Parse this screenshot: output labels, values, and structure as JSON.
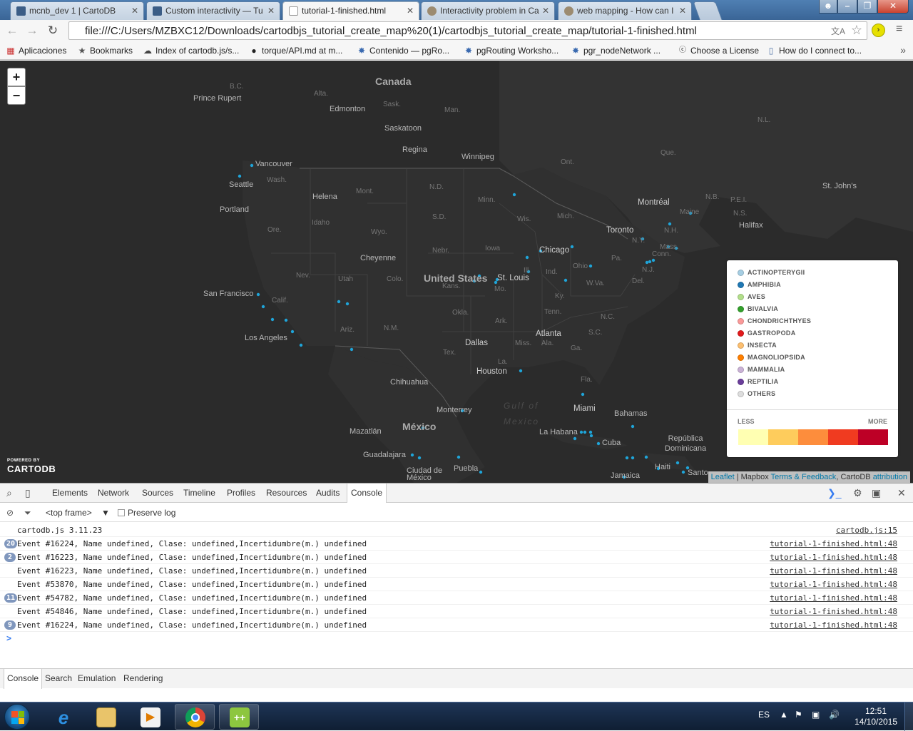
{
  "browser": {
    "tabs": [
      {
        "title": "mcnb_dev 1 | CartoDB",
        "favicon_color": "#3b5d86"
      },
      {
        "title": "Custom interactivity — Tu",
        "favicon_color": "#3b5d86"
      },
      {
        "title": "tutorial-1-finished.html",
        "favicon_color": "#ffffff"
      },
      {
        "title": "Interactivity problem in Ca",
        "favicon_color": "#9c8b70"
      },
      {
        "title": "web mapping - How can I",
        "favicon_color": "#9c8b70"
      }
    ],
    "url": "file:///C:/Users/MZBXC12/Downloads/cartodbjs_tutorial_create_map%20(1)/cartodbjs_tutorial_create_map/tutorial-1-finished.html",
    "bookmarks": [
      {
        "label": "Aplicaciones",
        "icon": "apps-grid-icon"
      },
      {
        "label": "Bookmarks",
        "icon": "star-icon"
      },
      {
        "label": "Index of cartodb.js/s...",
        "icon": "cloud-icon"
      },
      {
        "label": "torque/API.md at m...",
        "icon": "github-icon"
      },
      {
        "label": "Contenido — pgRo...",
        "icon": "pgrouting-icon"
      },
      {
        "label": "pgRouting Worksho...",
        "icon": "pgrouting-icon"
      },
      {
        "label": "pgr_nodeNetwork ...",
        "icon": "pgrouting-icon"
      },
      {
        "label": "Choose a License",
        "icon": "cc-icon"
      },
      {
        "label": "How do I connect to...",
        "icon": "page-icon"
      }
    ]
  },
  "map": {
    "zoom_in": "+",
    "zoom_out": "−",
    "countries": {
      "canada": "Canada",
      "usa": "United States",
      "mexico": "México"
    },
    "cities": {
      "prince_rupert": "Prince Rupert",
      "edmonton": "Edmonton",
      "saskatoon": "Saskatoon",
      "regina": "Regina",
      "winnipeg": "Winnipeg",
      "vancouver": "Vancouver",
      "seattle": "Seattle",
      "portland": "Portland",
      "helena": "Helena",
      "cheyenne": "Cheyenne",
      "san_francisco": "San Francisco",
      "los_angeles": "Los Angeles",
      "chicago": "Chicago",
      "st_louis": "St. Louis",
      "toronto": "Toronto",
      "montreal": "Montréal",
      "halifax": "Halifax",
      "st_johns": "St. John's",
      "dallas": "Dallas",
      "houston": "Houston",
      "atlanta": "Atlanta",
      "miami": "Miami",
      "chihuahua": "Chihuahua",
      "monterrey": "Monterrey",
      "mazatlan": "Mazatlán",
      "guadalajara": "Guadalajara",
      "ciudad_de_mexico": "Ciudad de\nMéxico",
      "puebla": "Puebla",
      "la_habana": "La Habana",
      "cuba": "Cuba",
      "bahamas": "Bahamas",
      "republica_dominicana": "República\nDominicana",
      "haiti": "Haiti",
      "jamaica": "Jamaica",
      "santo": "Santo"
    },
    "regions": {
      "bc": "B.C.",
      "alta": "Alta.",
      "sask": "Sask.",
      "man": "Man.",
      "ont": "Ont.",
      "que": "Que.",
      "nl": "N.L.",
      "nb": "N.B.",
      "pei": "P.E.I.",
      "ns": "N.S.",
      "wash": "Wash.",
      "ore": "Ore.",
      "idaho": "Idaho",
      "mont": "Mont.",
      "wyo": "Wyo.",
      "nd": "N.D.",
      "sd": "S.D.",
      "nebr": "Nebr.",
      "minn": "Minn.",
      "wis": "Wis.",
      "mich": "Mich.",
      "iowa": "Iowa",
      "nev": "Nev.",
      "utah": "Utah",
      "colo": "Colo.",
      "kans": "Kans.",
      "mo": "Mo.",
      "ill": "Ill.",
      "ind": "Ind.",
      "ohio": "Ohio",
      "calif": "Calif.",
      "ariz": "Ariz.",
      "nm": "N.M.",
      "okla": "Okla.",
      "ark": "Ark.",
      "ky": "Ky.",
      "tenn": "Tenn.",
      "wva": "W.Va.",
      "pa": "Pa.",
      "ny": "N.Y.",
      "nj": "N.J.",
      "del": "Del.",
      "nc": "N.C.",
      "sc": "S.C.",
      "tex": "Tex.",
      "miss": "Miss.",
      "ala": "Ala.",
      "ga": "Ga.",
      "la": "La.",
      "fla": "Fla.",
      "maine": "Maine",
      "nh": "N.H.",
      "mass": "Mass.",
      "conn": "Conn."
    },
    "sea_label": "Gulf of\nMexico",
    "legend": {
      "items": [
        {
          "label": "ACTINOPTERYGII",
          "color": "#a6cee3"
        },
        {
          "label": "AMPHIBIA",
          "color": "#1f78b4"
        },
        {
          "label": "AVES",
          "color": "#b2df8a"
        },
        {
          "label": "BIVALVIA",
          "color": "#33a02c"
        },
        {
          "label": "CHONDRICHTHYES",
          "color": "#fb9a99"
        },
        {
          "label": "GASTROPODA",
          "color": "#e31a1c"
        },
        {
          "label": "INSECTA",
          "color": "#fdbf6f"
        },
        {
          "label": "MAGNOLIOPSIDA",
          "color": "#ff7f00"
        },
        {
          "label": "MAMMALIA",
          "color": "#cab2d6"
        },
        {
          "label": "REPTILIA",
          "color": "#6a3d9a"
        },
        {
          "label": "OTHERS",
          "color": "#dddddd"
        }
      ],
      "less": "LESS",
      "more": "MORE",
      "scale_colors": [
        "#ffffb2",
        "#fecc5c",
        "#fd8d3c",
        "#f03b20",
        "#bd0026"
      ]
    },
    "powered_by": "POWERED BY",
    "brand": "CARTODB",
    "attribution": {
      "leaflet": "Leaflet",
      "mapbox": "Mapbox",
      "terms": "Terms & Feedback",
      "cartodb": "CartoDB",
      "attr": "attribution"
    },
    "point_color": "#1fa4d8"
  },
  "devtools": {
    "tabs": [
      "Elements",
      "Network",
      "Sources",
      "Timeline",
      "Profiles",
      "Resources",
      "Audits",
      "Console"
    ],
    "active_tab": "Console",
    "frame_selector": "<top frame>",
    "preserve_log": "Preserve log",
    "log": [
      {
        "count": "",
        "message": "cartodb.js 3.11.23",
        "source": "cartodb.js:15"
      },
      {
        "count": "20",
        "message": "Event #16224, Name undefined, Clase: undefined,Incertidumbre(m.) undefined",
        "source": "tutorial-1-finished.html:48"
      },
      {
        "count": "2",
        "message": "Event #16223, Name undefined, Clase: undefined,Incertidumbre(m.) undefined",
        "source": "tutorial-1-finished.html:48"
      },
      {
        "count": "",
        "message": "Event #16223, Name undefined, Clase: undefined,Incertidumbre(m.) undefined",
        "source": "tutorial-1-finished.html:48"
      },
      {
        "count": "",
        "message": "Event #53870, Name undefined, Clase: undefined,Incertidumbre(m.) undefined",
        "source": "tutorial-1-finished.html:48"
      },
      {
        "count": "11",
        "message": "Event #54782, Name undefined, Clase: undefined,Incertidumbre(m.) undefined",
        "source": "tutorial-1-finished.html:48"
      },
      {
        "count": "",
        "message": "Event #54846, Name undefined, Clase: undefined,Incertidumbre(m.) undefined",
        "source": "tutorial-1-finished.html:48"
      },
      {
        "count": "9",
        "message": "Event #16224, Name undefined, Clase: undefined,Incertidumbre(m.) undefined",
        "source": "tutorial-1-finished.html:48"
      }
    ],
    "prompt": ">",
    "drawer_tabs": [
      "Console",
      "Search",
      "Emulation",
      "Rendering"
    ]
  },
  "taskbar": {
    "language": "ES",
    "time": "12:51",
    "date": "14/10/2015"
  }
}
